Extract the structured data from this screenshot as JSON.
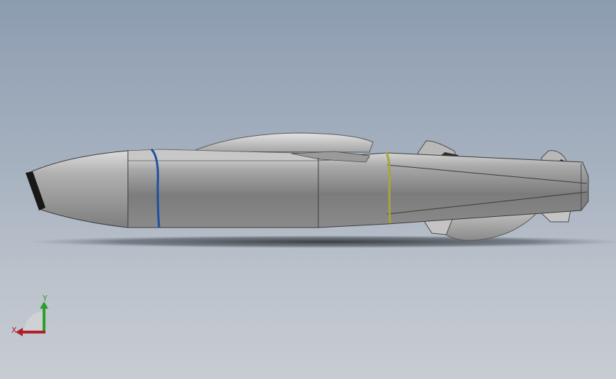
{
  "viewport": {
    "background_top": "#8c9cb0",
    "background_bottom": "#c8ccd2"
  },
  "model": {
    "body_color": "#7b7b7b",
    "highlight_color": "#c8c8c8",
    "band_blue": "#1f4fa0",
    "band_yellow": "#a6a63a",
    "nose_dark": "#1a1a1a",
    "shadow_color": "#2a2e33"
  },
  "triad": {
    "x_label": "X",
    "y_label": "Y",
    "x_color": "#b0202a",
    "y_color": "#2aa02a"
  }
}
